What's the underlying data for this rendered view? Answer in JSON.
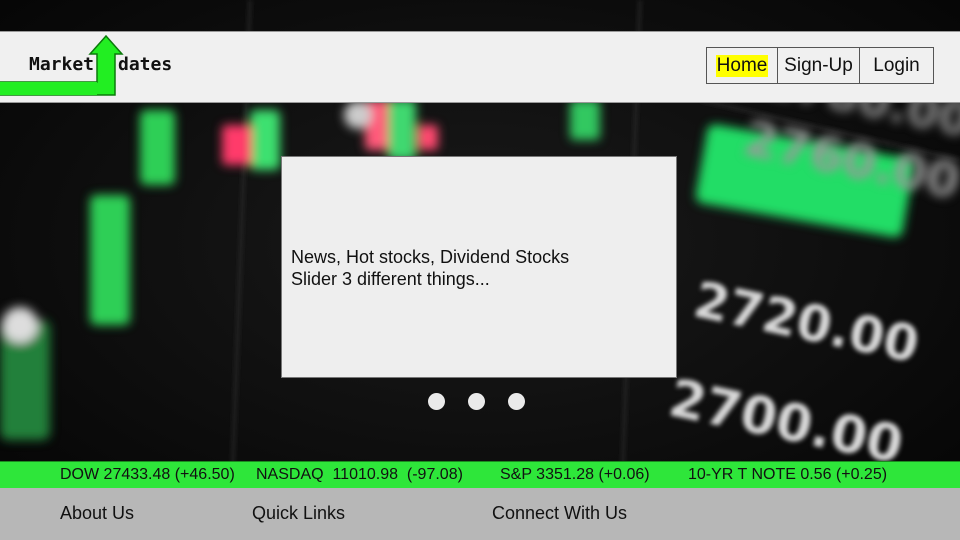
{
  "header": {
    "logo": {
      "text_left": "Market",
      "text_right": "dates",
      "arrow_color": "#22ee22"
    },
    "nav": [
      {
        "label": "Home",
        "highlighted": true
      },
      {
        "label": "Sign-Up"
      },
      {
        "label": "Login"
      }
    ]
  },
  "slider": {
    "line1": "News, Hot stocks, Dividend Stocks",
    "line2": "Slider 3 different things...",
    "dot_count": 3
  },
  "background": {
    "price_labels": [
      "2720.00",
      "2700.00"
    ]
  },
  "ticker": {
    "dow": "DOW 27433.48 (+46.50)",
    "nasdaq": "NASDAQ  11010.98  (-97.08)",
    "sp": "S&P 3351.28 (+0.06)",
    "note": "10-YR T NOTE 0.56 (+0.25)",
    "color": "#2ee63a"
  },
  "footer": {
    "about": "About Us",
    "quick": "Quick Links",
    "connect": "Connect With Us"
  }
}
